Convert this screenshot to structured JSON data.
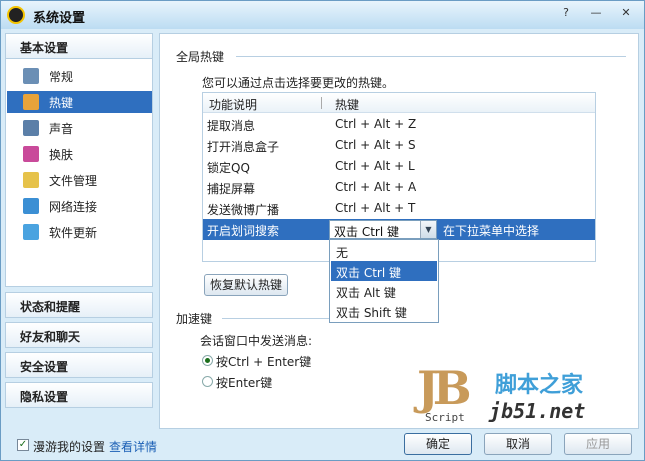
{
  "window": {
    "title": "系统设置",
    "help": "?",
    "minimize": "—",
    "close": "✕"
  },
  "sidebar": {
    "top_category": "基本设置",
    "items": [
      {
        "label": "常规",
        "icon": "general-icon",
        "color": "#6b8fb5"
      },
      {
        "label": "热键",
        "icon": "hotkey-icon",
        "color": "#e8a33a"
      },
      {
        "label": "声音",
        "icon": "speaker-icon",
        "color": "#5b7fa8"
      },
      {
        "label": "换肤",
        "icon": "skin-icon",
        "color": "#c94a9a"
      },
      {
        "label": "文件管理",
        "icon": "folder-icon",
        "color": "#e6c24a"
      },
      {
        "label": "网络连接",
        "icon": "network-icon",
        "color": "#3b8fd4"
      },
      {
        "label": "软件更新",
        "icon": "update-icon",
        "color": "#4aa3e0"
      }
    ],
    "selected_index": 1,
    "categories": [
      "状态和提醒",
      "好友和聊天",
      "安全设置",
      "隐私设置"
    ]
  },
  "global_hotkeys": {
    "title": "全局热键",
    "description": "您可以通过点击选择要更改的热键。",
    "columns": [
      "功能说明",
      "热键"
    ],
    "rows": [
      {
        "name": "提取消息",
        "key": "Ctrl + Alt + Z"
      },
      {
        "name": "打开消息盒子",
        "key": "Ctrl + Alt + S"
      },
      {
        "name": "锁定QQ",
        "key": "Ctrl + Alt + L"
      },
      {
        "name": "捕捉屏幕",
        "key": "Ctrl + Alt + A"
      },
      {
        "name": "发送微博广播",
        "key": "Ctrl + Alt + T"
      },
      {
        "name": "开启划词搜索",
        "key": "双击 Ctrl 键",
        "hint": "在下拉菜单中选择"
      }
    ],
    "dropdown_options": [
      "无",
      "双击 Ctrl 键",
      "双击 Alt 键",
      "双击 Shift 键"
    ],
    "dropdown_selected": 1,
    "restore_button": "恢复默认热键"
  },
  "accelerator": {
    "title": "加速键",
    "subtitle": "会话窗口中发送消息:",
    "options": [
      "按Ctrl + Enter键",
      "按Enter键"
    ],
    "selected": 0
  },
  "footer": {
    "roaming_label": "漫游我的设置",
    "roaming_checked": true,
    "details_link": "查看详情",
    "ok": "确定",
    "cancel": "取消",
    "apply": "应用"
  },
  "watermark": {
    "brand": "JB",
    "script": "Script",
    "site_cn": "脚本之家",
    "site_url": "jb51.net"
  }
}
